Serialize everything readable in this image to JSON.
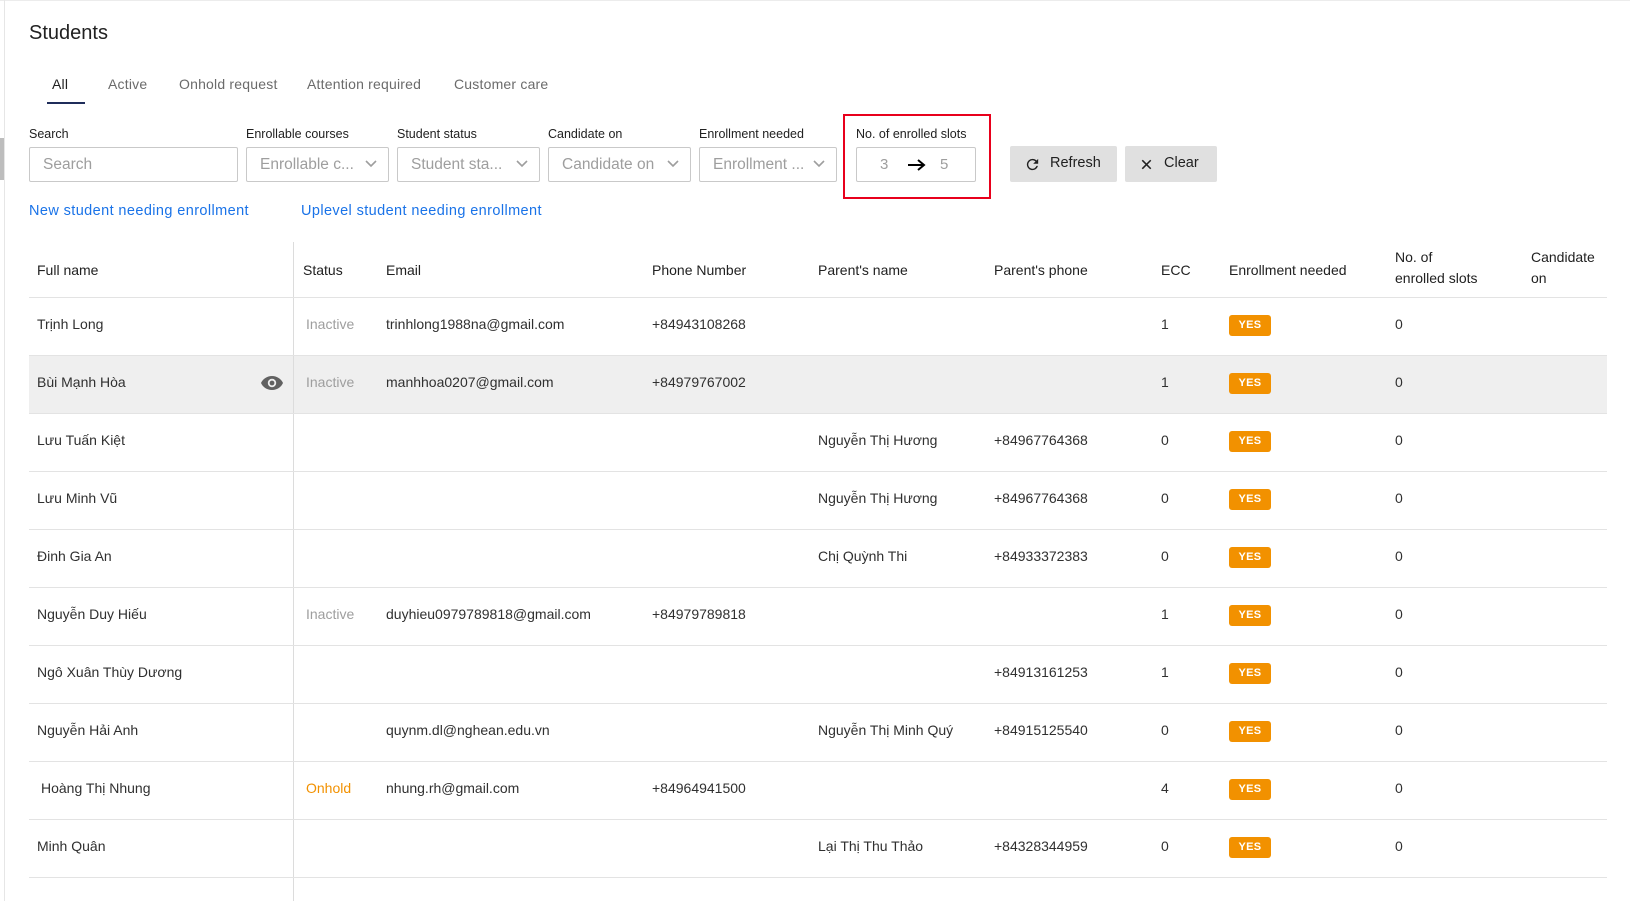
{
  "page": {
    "title": "Students"
  },
  "tabs": [
    {
      "label": "All",
      "active": true
    },
    {
      "label": "Active"
    },
    {
      "label": "Onhold request"
    },
    {
      "label": "Attention required"
    },
    {
      "label": "Customer care"
    }
  ],
  "filters": {
    "search": {
      "label": "Search",
      "placeholder": "Search"
    },
    "enrollable_courses": {
      "label": "Enrollable courses",
      "placeholder": "Enrollable c..."
    },
    "student_status": {
      "label": "Student status",
      "placeholder": "Student sta..."
    },
    "candidate_on": {
      "label": "Candidate on",
      "placeholder": "Candidate on"
    },
    "enrollment_needed": {
      "label": "Enrollment needed",
      "placeholder": "Enrollment ..."
    },
    "enrolled_slots": {
      "label": "No. of enrolled slots",
      "min": "3",
      "max": "5"
    }
  },
  "buttons": {
    "refresh": "Refresh",
    "clear": "Clear"
  },
  "links": {
    "new_student": "New student needing enrollment",
    "uplevel_student": "Uplevel student needing enrollment"
  },
  "table": {
    "headers": {
      "full_name": "Full name",
      "status": "Status",
      "email": "Email",
      "phone": "Phone Number",
      "parent_name": "Parent's name",
      "parent_phone": "Parent's phone",
      "ecc": "ECC",
      "enrollment_needed": "Enrollment needed",
      "enrolled_slots_1": "No. of",
      "enrolled_slots_2": "enrolled slots",
      "candidate_on_1": "Candidate",
      "candidate_on_2": "on"
    },
    "rows": [
      {
        "name": "Trịnh Long",
        "status": "Inactive",
        "email": "trinhlong1988na@gmail.com",
        "phone": "+84943108268",
        "parent_name": "",
        "parent_phone": "",
        "ecc": "1",
        "enrollment": "YES",
        "slots": "0"
      },
      {
        "name": "Bùi Mạnh Hòa",
        "status": "Inactive",
        "email": "manhhoa0207@gmail.com",
        "phone": "+84979767002",
        "parent_name": "",
        "parent_phone": "",
        "ecc": "1",
        "enrollment": "YES",
        "slots": "0"
      },
      {
        "name": "Lưu Tuấn Kiệt",
        "status": "",
        "email": "",
        "phone": "",
        "parent_name": "Nguyễn Thị Hương",
        "parent_phone": "+84967764368",
        "ecc": "0",
        "enrollment": "YES",
        "slots": "0"
      },
      {
        "name": "Lưu Minh Vũ",
        "status": "",
        "email": "",
        "phone": "",
        "parent_name": "Nguyễn Thị Hương",
        "parent_phone": "+84967764368",
        "ecc": "0",
        "enrollment": "YES",
        "slots": "0"
      },
      {
        "name": "Đinh Gia An",
        "status": "",
        "email": "",
        "phone": "",
        "parent_name": "Chị Quỳnh Thi",
        "parent_phone": "+84933372383",
        "ecc": "0",
        "enrollment": "YES",
        "slots": "0"
      },
      {
        "name": "Nguyễn Duy Hiếu",
        "status": "Inactive",
        "email": "duyhieu0979789818@gmail.com",
        "phone": "+84979789818",
        "parent_name": "",
        "parent_phone": "",
        "ecc": "1",
        "enrollment": "YES",
        "slots": "0"
      },
      {
        "name": "Ngô Xuân Thùy Dương",
        "status": "",
        "email": "",
        "phone": "",
        "parent_name": "",
        "parent_phone": "+84913161253",
        "ecc": "1",
        "enrollment": "YES",
        "slots": "0"
      },
      {
        "name": "Nguyễn Hải Anh",
        "status": "",
        "email": "quynm.dl@nghean.edu.vn",
        "phone": "",
        "parent_name": "Nguyễn Thị Minh Quý",
        "parent_phone": "+84915125540",
        "ecc": "0",
        "enrollment": "YES",
        "slots": "0"
      },
      {
        "name": "Hoàng Thị Nhung",
        "status": "Onhold",
        "email": "nhung.rh@gmail.com",
        "phone": "+84964941500",
        "parent_name": "",
        "parent_phone": "",
        "ecc": "4",
        "enrollment": "YES",
        "slots": "0"
      },
      {
        "name": "Minh Quân",
        "status": "",
        "email": "",
        "phone": "",
        "parent_name": "Lại Thị Thu Thảo",
        "parent_phone": "+84328344959",
        "ecc": "0",
        "enrollment": "YES",
        "slots": "0"
      }
    ]
  },
  "colors": {
    "accent_blue": "#1a73e8",
    "badge_orange": "#f29100",
    "highlight_red": "#e8001c",
    "inactive_gray": "#9e9e9e",
    "tab_indicator": "#1f2d5a"
  },
  "icons": {
    "refresh": "refresh-icon",
    "clear": "close-icon",
    "dropdown": "chevron-down-icon",
    "arrow": "arrow-right-icon",
    "view": "eye-icon"
  }
}
